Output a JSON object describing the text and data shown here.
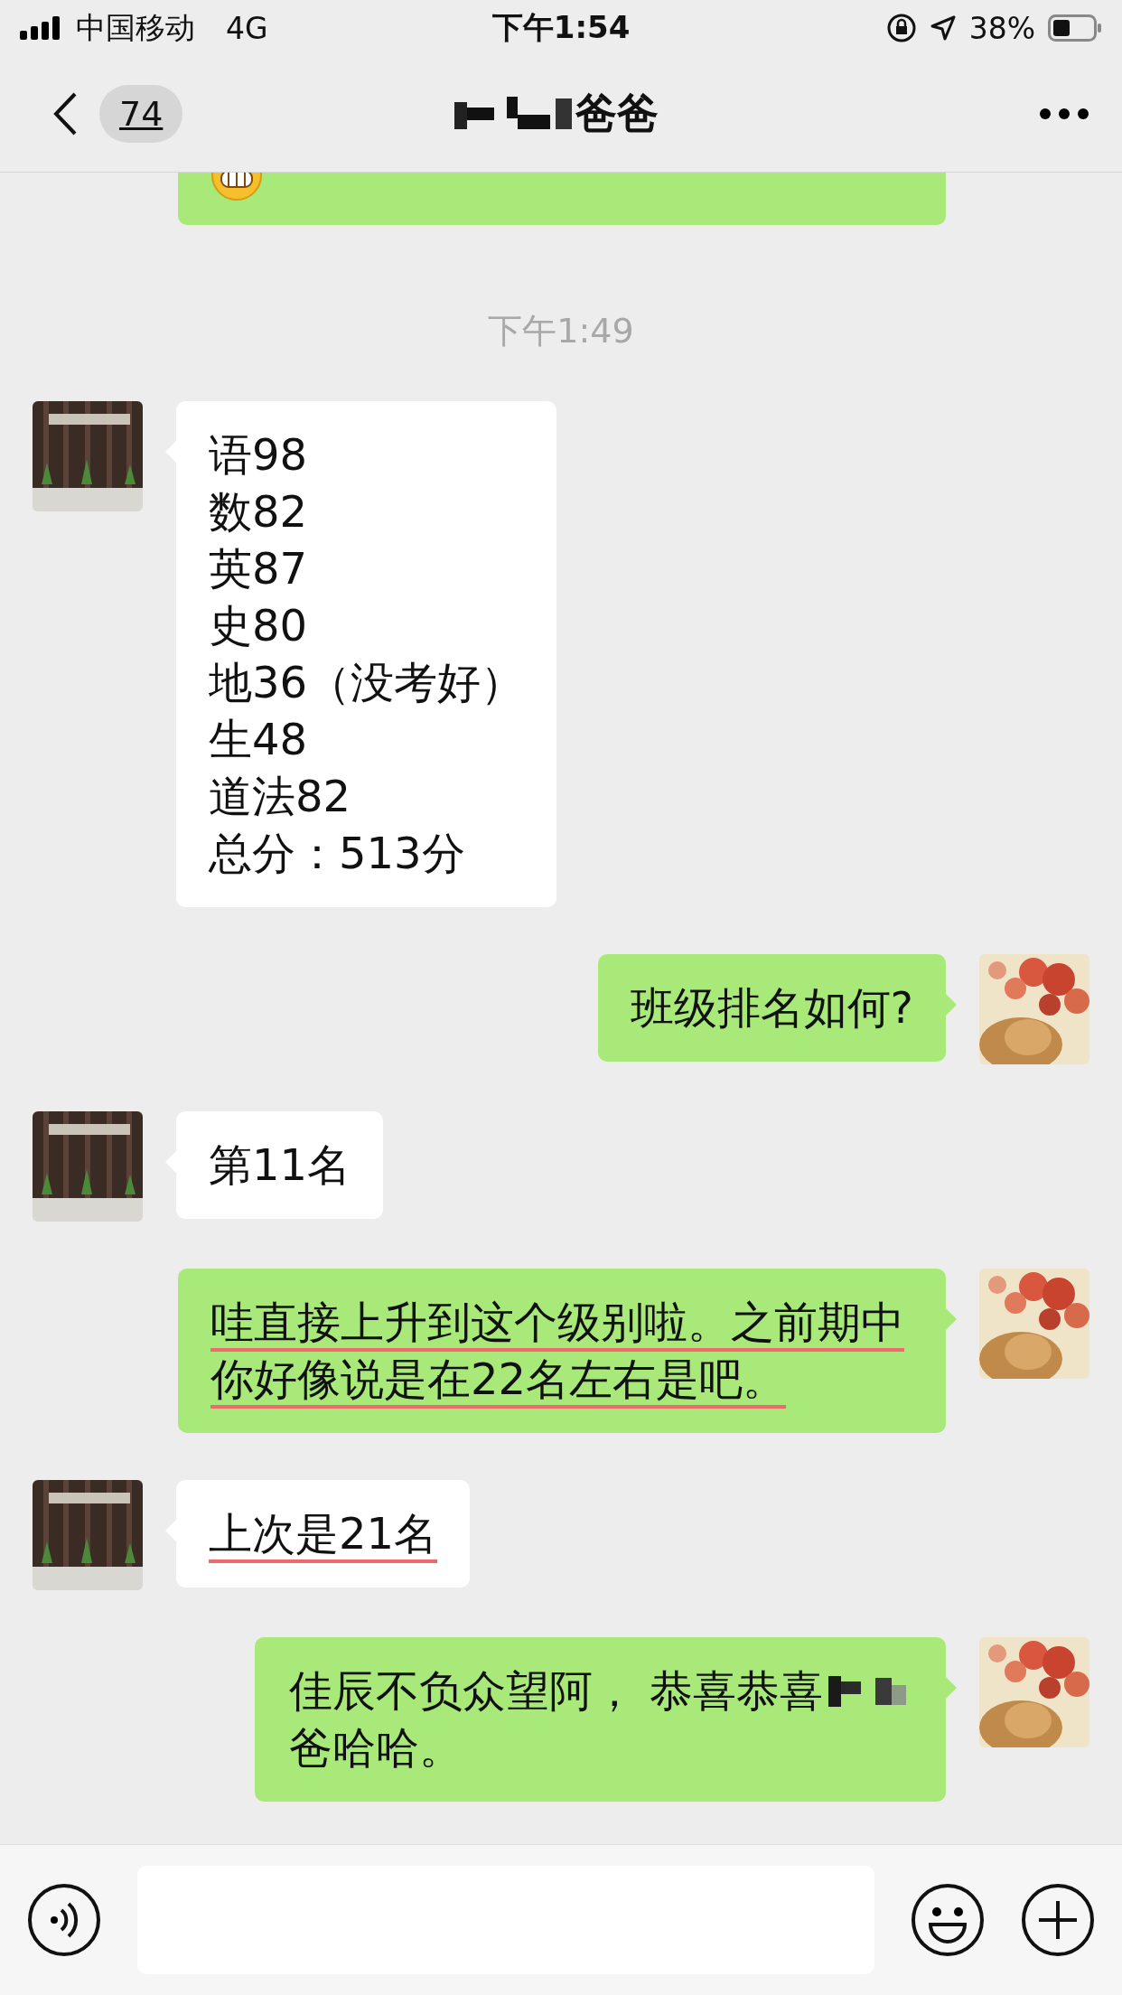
{
  "status_bar": {
    "carrier": "中国移动",
    "network": "4G",
    "time": "下午1:54",
    "battery": "38%"
  },
  "nav": {
    "unread": "74",
    "title": "爸爸"
  },
  "messages": [
    {
      "kind": "partial",
      "outgoing": true
    },
    {
      "kind": "time",
      "text": "下午1:49"
    },
    {
      "kind": "lines",
      "outgoing": false,
      "lines": [
        "语98",
        "数82",
        "英87",
        "史80",
        "地36（没考好）",
        "生48",
        "道法82",
        "总分：513分"
      ]
    },
    {
      "kind": "text",
      "outgoing": true,
      "text": "班级排名如何?",
      "underlined": false
    },
    {
      "kind": "text",
      "outgoing": false,
      "text": "第11名",
      "underlined": false
    },
    {
      "kind": "text",
      "outgoing": true,
      "text": "哇直接上升到这个级别啦。之前期中你好像说是在22名左右是吧。",
      "underlined": true
    },
    {
      "kind": "text",
      "outgoing": false,
      "text": "上次是21名",
      "underlined": true
    },
    {
      "kind": "redacted",
      "outgoing": true,
      "before": "佳辰不负众望阿， 恭喜恭喜",
      "after": "爸哈哈。",
      "underlined": false
    }
  ]
}
